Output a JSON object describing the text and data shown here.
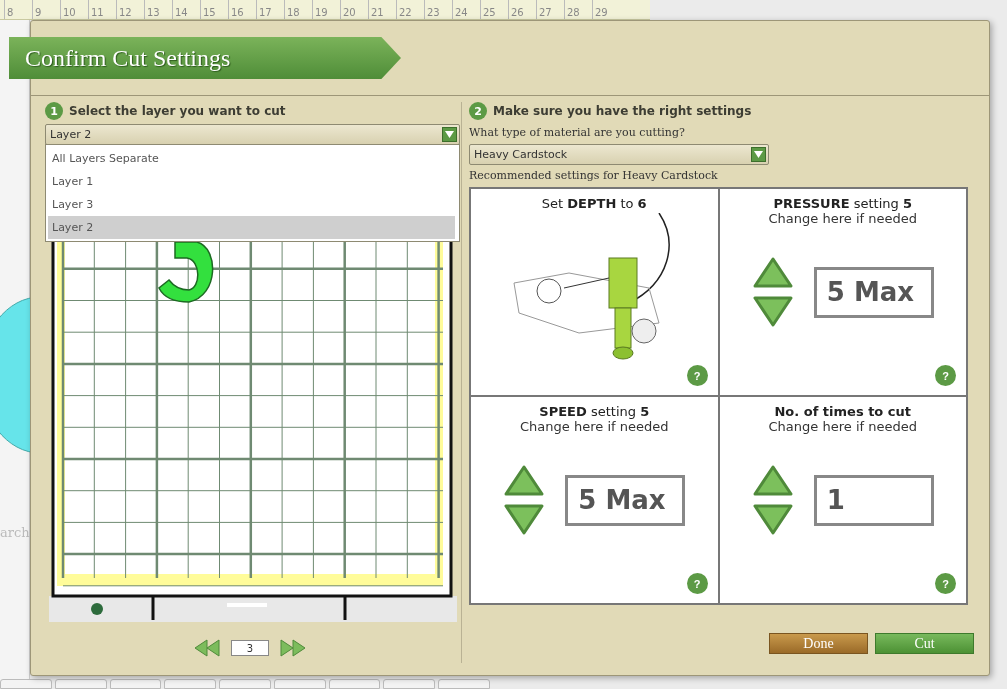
{
  "background": {
    "ruler_labels": [
      "8",
      "9",
      "10",
      "11",
      "12",
      "13",
      "14",
      "15",
      "16",
      "17",
      "18",
      "19",
      "20",
      "21",
      "22",
      "23",
      "24",
      "25",
      "26",
      "27",
      "28",
      "29"
    ],
    "side_label": "arch"
  },
  "dialog": {
    "title": "Confirm Cut Settings",
    "layer_section": {
      "step": "1",
      "heading": "Select the layer you want to cut",
      "select": {
        "value": "Layer 2",
        "expanded": true
      },
      "options": [
        {
          "label": "All Layers Separate",
          "selected": false
        },
        {
          "label": "Layer 1",
          "selected": false
        },
        {
          "label": "Layer 3",
          "selected": false
        },
        {
          "label": "Layer 2",
          "selected": true
        }
      ],
      "pager": {
        "value": "3"
      }
    },
    "settings_section": {
      "step": "2",
      "heading": "Make sure you have the right settings",
      "question": "What type of material are you cutting?",
      "material": {
        "value": "Heavy Cardstock"
      },
      "recommended": "Recommended settings for Heavy Cardstock",
      "cards": [
        {
          "kind": "image",
          "title": "Set **DEPTH** to **6**",
          "help": "?"
        },
        {
          "kind": "stepper",
          "title": "**PRESSURE** setting **5**",
          "subtitle": "Change here if needed",
          "value": "5 Max",
          "emphasis": false,
          "help": "?"
        },
        {
          "kind": "stepper",
          "title": "**SPEED** setting **5**",
          "subtitle": "Change here if needed",
          "value": "5 Max",
          "emphasis": false,
          "help": "?"
        },
        {
          "kind": "stepper",
          "title": "No. of times to cut",
          "subtitle": "Change here if needed",
          "value": "1",
          "emphasis": true,
          "help": "?"
        }
      ]
    },
    "buttons": [
      {
        "label": "Done",
        "kind": "secondary"
      },
      {
        "label": "Cut",
        "kind": "primary"
      }
    ]
  }
}
